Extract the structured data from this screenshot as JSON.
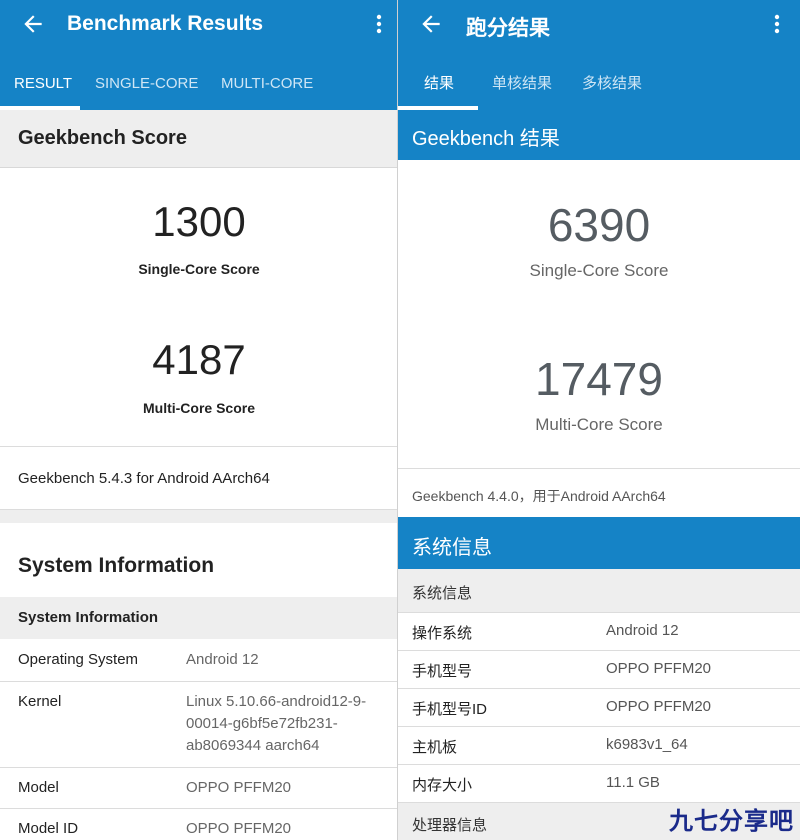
{
  "left": {
    "title": "Benchmark Results",
    "tabs": [
      {
        "label": "RESULT",
        "active": true
      },
      {
        "label": "SINGLE-CORE",
        "active": false
      },
      {
        "label": "MULTI-CORE",
        "active": false
      }
    ],
    "section_title": "Geekbench Score",
    "single_core": {
      "value": "1300",
      "label": "Single-Core Score"
    },
    "multi_core": {
      "value": "4187",
      "label": "Multi-Core Score"
    },
    "version": "Geekbench 5.4.3 for Android AArch64",
    "sysinfo_heading": "System Information",
    "sysinfo_subheading": "System Information",
    "rows": [
      {
        "label": "Operating System",
        "value": "Android 12"
      },
      {
        "label": "Kernel",
        "value_lines": [
          "Linux 5.10.66-android12-9-",
          "00014-g6bf5e72fb231-",
          "ab8069344 aarch64"
        ]
      },
      {
        "label": "Model",
        "value": "OPPO PFFM20"
      },
      {
        "label": "Model ID",
        "value": "OPPO PFFM20"
      }
    ]
  },
  "right": {
    "title": "跑分结果",
    "tabs": [
      {
        "label": "结果",
        "active": true
      },
      {
        "label": "单核结果",
        "active": false
      },
      {
        "label": "多核结果",
        "active": false
      }
    ],
    "section_title": "Geekbench 结果",
    "single_core": {
      "value": "6390",
      "label": "Single-Core Score"
    },
    "multi_core": {
      "value": "17479",
      "label": "Multi-Core Score"
    },
    "version": "Geekbench 4.4.0，用于Android AArch64",
    "sysinfo_heading": "系统信息",
    "sysinfo_subheading": "系统信息",
    "rows": [
      {
        "label": "操作系统",
        "value": "Android 12"
      },
      {
        "label": "手机型号",
        "value": "OPPO PFFM20"
      },
      {
        "label": "手机型号ID",
        "value": "OPPO PFFM20"
      },
      {
        "label": "主机板",
        "value": "k6983v1_64"
      },
      {
        "label": "内存大小",
        "value": "11.1 GB"
      }
    ],
    "processor_heading": "处理器信息"
  },
  "watermark": "九七分享吧",
  "colors": {
    "app_bar": "#1583c6",
    "section_gray": "#eeeeee",
    "text_dark": "#222222",
    "text_muted": "#666666"
  },
  "icons": {
    "back": "arrow-left-icon",
    "more": "more-vertical-icon"
  }
}
